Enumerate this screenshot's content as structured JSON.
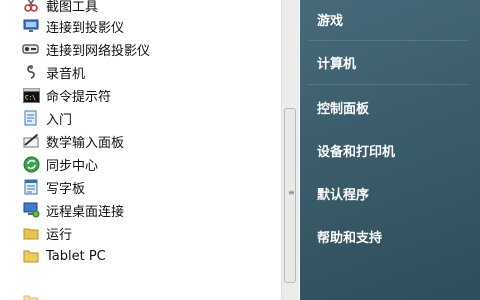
{
  "programs": [
    {
      "label": "截图工具",
      "icon": "scissors-icon"
    },
    {
      "label": "连接到投影仪",
      "icon": "projector-monitor-icon"
    },
    {
      "label": "连接到网络投影仪",
      "icon": "network-projector-icon"
    },
    {
      "label": "录音机",
      "icon": "microphone-icon"
    },
    {
      "label": "命令提示符",
      "icon": "command-prompt-icon"
    },
    {
      "label": "入门",
      "icon": "getting-started-icon"
    },
    {
      "label": "数学输入面板",
      "icon": "math-input-icon"
    },
    {
      "label": "同步中心",
      "icon": "sync-center-icon"
    },
    {
      "label": "写字板",
      "icon": "wordpad-icon"
    },
    {
      "label": "远程桌面连接",
      "icon": "remote-desktop-icon"
    },
    {
      "label": "运行",
      "icon": "run-folder-icon"
    },
    {
      "label": "Tablet PC",
      "icon": "folder-icon"
    }
  ],
  "right_menu": [
    {
      "label": "游戏"
    },
    {
      "label": "计算机"
    },
    {
      "label": "控制面板"
    },
    {
      "label": "设备和打印机"
    },
    {
      "label": "默认程序"
    },
    {
      "label": "帮助和支持"
    }
  ],
  "colors": {
    "right_panel": "#3f6170",
    "left_panel": "#ffffff"
  }
}
